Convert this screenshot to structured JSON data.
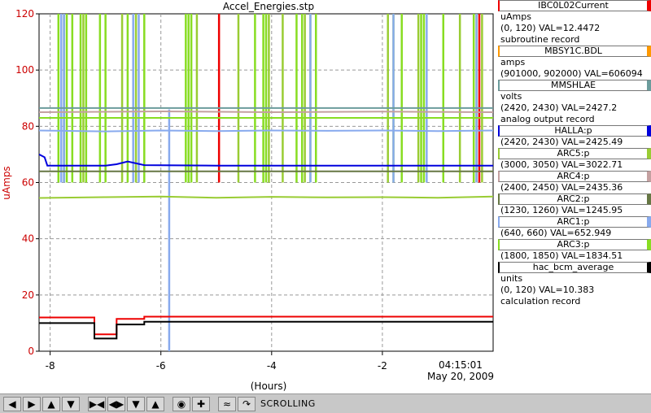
{
  "chart_data": {
    "type": "line",
    "title": "Accel_Energies.stp",
    "xlabel": "(Hours)",
    "ylabel": "uAmps",
    "xlim": [
      -8.2,
      0
    ],
    "ylim": [
      0,
      120
    ],
    "x_ticks": [
      -8,
      -6,
      -4,
      -2
    ],
    "x_tick_labels": [
      "-8",
      "-6",
      "-4",
      "-2"
    ],
    "y_ticks": [
      0,
      20,
      40,
      60,
      80,
      100,
      120
    ],
    "y_tick_labels": [
      "0",
      "20",
      "40",
      "60",
      "80",
      "100",
      "120"
    ],
    "end_time_label": "04:15:01",
    "end_date_label": "May 20, 2009",
    "grid": true,
    "series": [
      {
        "name": "MMSHLAE",
        "color": "#6b9c9c",
        "x": [
          -8.2,
          0
        ],
        "y": [
          86.5,
          86.5
        ]
      },
      {
        "name": "ARC4:p",
        "color": "#c4a0a0",
        "x": [
          -8.2,
          -6,
          -4,
          -2,
          0
        ],
        "y": [
          85.0,
          85.3,
          85.0,
          85.2,
          85.0
        ]
      },
      {
        "name": "ARC3:p",
        "color": "#88dd22",
        "x": [
          -8.2,
          -7,
          -6,
          -5,
          -4,
          -3,
          -2,
          -1,
          0
        ],
        "y": [
          83.0,
          83.0,
          83.0,
          83.0,
          83.0,
          83.0,
          83.0,
          83.0,
          83.0
        ]
      },
      {
        "name": "ARC1:p",
        "color": "#88aaee",
        "x": [
          -8.2,
          -7,
          -6,
          -5,
          -4,
          -3,
          -2,
          -1,
          0
        ],
        "y": [
          78.5,
          78.2,
          78.5,
          78.3,
          78.5,
          78.4,
          78.5,
          78.3,
          78.5
        ]
      },
      {
        "name": "HALLA:p",
        "color": "#0000dd",
        "x": [
          -8.2,
          -8.1,
          -8.05,
          -7.0,
          -6.8,
          -6.6,
          -6.3,
          -5.0,
          -4.0,
          -3.0,
          -2.0,
          -1.0,
          0
        ],
        "y": [
          70.0,
          69.0,
          66.0,
          66.0,
          66.5,
          67.5,
          66.2,
          66.0,
          66.0,
          66.0,
          66.0,
          66.0,
          66.0
        ]
      },
      {
        "name": "ARC2:p",
        "color": "#667744",
        "x": [
          -8.2,
          0
        ],
        "y": [
          64.0,
          64.0
        ]
      },
      {
        "name": "ARC5:p",
        "color": "#99cc33",
        "x": [
          -8.2,
          -7,
          -6,
          -5,
          -4,
          -3,
          -2,
          -1,
          0
        ],
        "y": [
          54.5,
          54.8,
          55.0,
          54.6,
          54.9,
          54.7,
          54.8,
          54.6,
          55.0
        ]
      },
      {
        "name": "IBC0L02Current",
        "color": "#ee0000",
        "x": [
          -8.2,
          -7.2,
          -7.2,
          -6.8,
          -6.8,
          -6.3,
          -6.3,
          -4.8,
          -4.0,
          -3.0,
          -2.0,
          -1.0,
          0
        ],
        "y": [
          12.0,
          12.0,
          6.0,
          6.0,
          11.5,
          11.5,
          12.3,
          12.3,
          12.3,
          12.3,
          12.3,
          12.3,
          12.3
        ]
      },
      {
        "name": "hac_bcm_average",
        "color": "#000000",
        "x": [
          -8.2,
          -7.2,
          -7.2,
          -6.8,
          -6.8,
          -6.3,
          -6.3,
          -4.0,
          0
        ],
        "y": [
          10.0,
          10.0,
          4.5,
          4.5,
          9.5,
          9.5,
          10.5,
          10.5,
          10.5
        ]
      }
    ],
    "spikes": [
      {
        "color": "#88dd22",
        "x": [
          -7.85,
          -7.7,
          -7.6,
          -7.45,
          -7.35,
          -7.1,
          -7.0,
          -6.6,
          -6.3,
          -5.55,
          -5.5,
          -5.45,
          -4.3,
          -4.15,
          -4.1,
          -3.55,
          -3.45,
          -3.3,
          -3.2,
          -1.8,
          -1.65,
          -1.3,
          -1.25,
          -0.9,
          -0.35,
          -0.3
        ]
      },
      {
        "color": "#99cc33",
        "x": [
          -7.75,
          -7.4,
          -6.7,
          -6.45,
          -5.35,
          -4.6,
          -4.05,
          -3.8,
          -3.4,
          -1.9,
          -1.35,
          -0.6,
          -0.2
        ]
      },
      {
        "color": "#88aaee",
        "x": [
          -7.8,
          -7.75,
          -6.5,
          -6.4,
          -3.3,
          -1.8,
          -1.2,
          -0.3
        ]
      },
      {
        "color": "#ee0000",
        "x": [
          -4.95,
          -0.25
        ]
      },
      {
        "color": "#88aaee",
        "x": [
          -5.85
        ],
        "low": true
      }
    ]
  },
  "legend": [
    {
      "title": "IBC0L02Current",
      "color": "#ee0000",
      "lines": [
        "uAmps",
        "(0, 120)  VAL=12.4472",
        "subroutine record"
      ]
    },
    {
      "title": "MBSY1C.BDL",
      "color": "#ff9900",
      "lines": [
        "amps",
        "(901000, 902000)  VAL=606094"
      ]
    },
    {
      "title": "MMSHLAE",
      "color": "#6b9c9c",
      "lines": [
        "volts",
        "(2420, 2430)  VAL=2427.2",
        "analog output record"
      ]
    },
    {
      "title": "HALLA:p",
      "color": "#0000dd",
      "lines": [
        "(2420, 2430)  VAL=2425.49"
      ]
    },
    {
      "title": "ARC5:p",
      "color": "#99cc33",
      "lines": [
        "(3000, 3050)  VAL=3022.71"
      ]
    },
    {
      "title": "ARC4:p",
      "color": "#c4a0a0",
      "lines": [
        "(2400, 2450)  VAL=2435.36"
      ]
    },
    {
      "title": "ARC2:p",
      "color": "#667744",
      "lines": [
        "(1230, 1260)  VAL=1245.95"
      ]
    },
    {
      "title": "ARC1:p",
      "color": "#88aaee",
      "lines": [
        "(640, 660)  VAL=652.949"
      ]
    },
    {
      "title": "ARC3:p",
      "color": "#88dd22",
      "lines": [
        "(1800, 1850)  VAL=1834.51"
      ]
    },
    {
      "title": "hac_bcm_average",
      "color": "#000000",
      "lines": [
        "units",
        "(0, 120)  VAL=10.383",
        "calculation record"
      ]
    }
  ],
  "toolbar": {
    "buttons": [
      "arrow-left-icon",
      "arrow-right-icon",
      "arrow-up-icon",
      "arrow-down-icon",
      "zoom-in-horizontal-icon",
      "zoom-out-horizontal-icon",
      "zoom-in-vertical-icon",
      "zoom-out-vertical-icon",
      "stagger-icon",
      "add-icon",
      "auto-scale-icon",
      "reset-icon"
    ],
    "status": "SCROLLING"
  }
}
